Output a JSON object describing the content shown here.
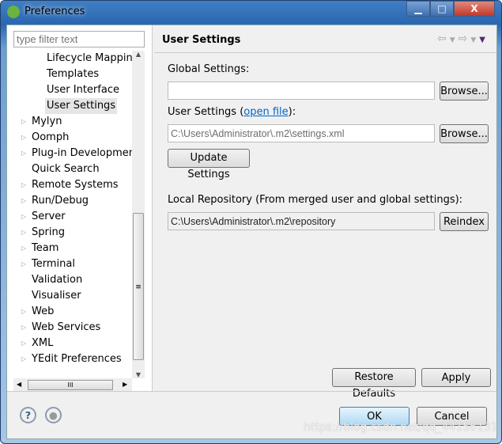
{
  "window": {
    "title": "Preferences",
    "minimize": "▁",
    "maximize": "□",
    "close": "X"
  },
  "sidebar": {
    "filter_placeholder": "type filter text",
    "items": [
      {
        "label": "Lifecycle Mapping",
        "indent": 2,
        "expandable": false
      },
      {
        "label": "Templates",
        "indent": 2,
        "expandable": false
      },
      {
        "label": "User Interface",
        "indent": 2,
        "expandable": false
      },
      {
        "label": "User Settings",
        "indent": 2,
        "expandable": false,
        "selected": true
      },
      {
        "label": "Mylyn",
        "indent": 1,
        "expandable": true
      },
      {
        "label": "Oomph",
        "indent": 1,
        "expandable": true
      },
      {
        "label": "Plug-in Development",
        "indent": 1,
        "expandable": true
      },
      {
        "label": "Quick Search",
        "indent": 1,
        "expandable": false
      },
      {
        "label": "Remote Systems",
        "indent": 1,
        "expandable": true
      },
      {
        "label": "Run/Debug",
        "indent": 1,
        "expandable": true
      },
      {
        "label": "Server",
        "indent": 1,
        "expandable": true
      },
      {
        "label": "Spring",
        "indent": 1,
        "expandable": true
      },
      {
        "label": "Team",
        "indent": 1,
        "expandable": true
      },
      {
        "label": "Terminal",
        "indent": 1,
        "expandable": true
      },
      {
        "label": "Validation",
        "indent": 1,
        "expandable": false
      },
      {
        "label": "Visualiser",
        "indent": 1,
        "expandable": false
      },
      {
        "label": "Web",
        "indent": 1,
        "expandable": true
      },
      {
        "label": "Web Services",
        "indent": 1,
        "expandable": true
      },
      {
        "label": "XML",
        "indent": 1,
        "expandable": true
      },
      {
        "label": "YEdit Preferences",
        "indent": 1,
        "expandable": true
      }
    ]
  },
  "page": {
    "title": "User Settings",
    "global_label": "Global Settings:",
    "global_value": "",
    "browse": "Browse...",
    "user_label": "User Settings (",
    "open_file": "open file",
    "user_label_end": "):",
    "user_value": "C:\\Users\\Administrator\\.m2\\settings.xml",
    "update": "Update Settings",
    "local_label": "Local Repository (From merged user and global settings):",
    "local_value": "C:\\Users\\Administrator\\.m2\\repository",
    "reindex": "Reindex",
    "restore": "Restore Defaults",
    "apply": "Apply"
  },
  "footer": {
    "help": "?",
    "ok": "OK",
    "cancel": "Cancel"
  },
  "watermark": "https://blog.csdn.net/qq_44156131"
}
